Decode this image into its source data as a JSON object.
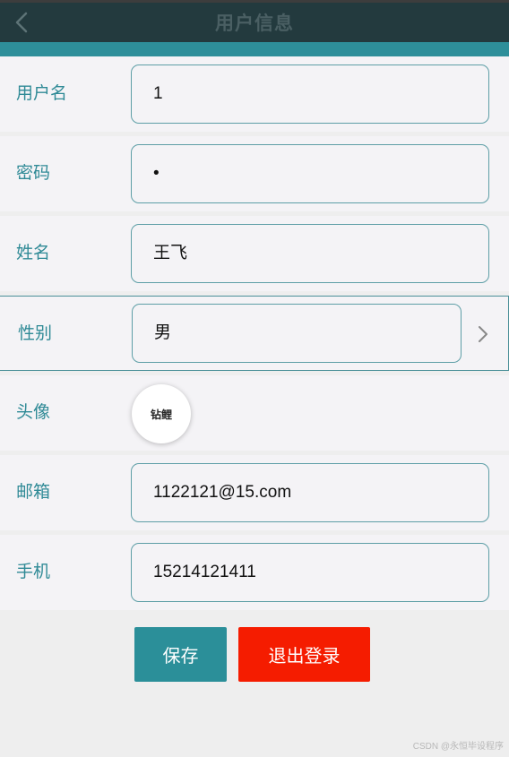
{
  "header": {
    "title": "用户信息",
    "back_icon": "chevron-left-icon"
  },
  "colors": {
    "header_bg": "#233a3e",
    "accent": "#2e8f9a",
    "label": "#2f8a96",
    "save_button": "#2b8f99",
    "logout_button": "#f51c00"
  },
  "form": {
    "username": {
      "label": "用户名",
      "value": "1"
    },
    "password": {
      "label": "密码",
      "value": "•"
    },
    "name": {
      "label": "姓名",
      "value": "王飞"
    },
    "gender": {
      "label": "性别",
      "value": "男",
      "icon": "chevron-right-icon"
    },
    "avatar": {
      "label": "头像",
      "image_text": "钻鲤"
    },
    "email": {
      "label": "邮箱",
      "value": "1122121@15.com"
    },
    "phone": {
      "label": "手机",
      "value": "15214121411"
    }
  },
  "buttons": {
    "save_label": "保存",
    "logout_label": "退出登录"
  },
  "watermark": "CSDN @永恒毕设程序"
}
